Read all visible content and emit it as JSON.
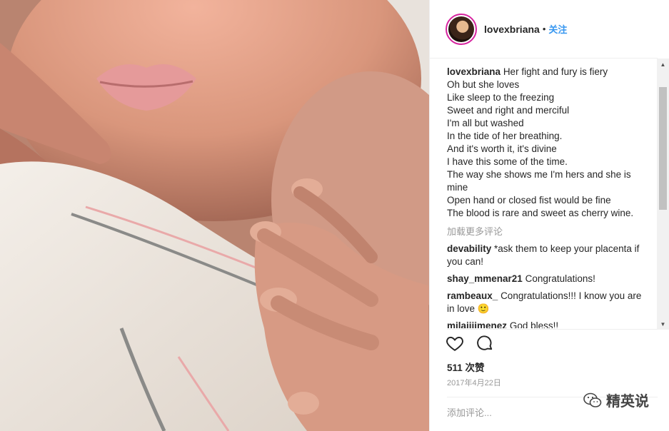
{
  "post": {
    "username": "lovexbriana",
    "dot": "•",
    "follow_label": "关注",
    "caption_lines": [
      "Her fight and fury is fiery",
      "Oh but she loves",
      "Like sleep to the freezing",
      "Sweet and right and merciful",
      "I'm all but washed",
      "In the tide of her breathing.",
      "And it's worth it, it's divine",
      "I have this some of the time.",
      "The way she shows me I'm hers and she is mine",
      "Open hand or closed fist would be fine",
      "The blood is rare and sweet as cherry wine."
    ],
    "load_more_label": "加载更多评论",
    "comments": [
      {
        "user": "devability",
        "text": "*ask them to keep your placenta if you can!"
      },
      {
        "user": "shay_mmenar21",
        "text": "Congratulations!"
      },
      {
        "user": "rambeaux_",
        "text": "Congratulations!!! I know you are in love 🙂"
      },
      {
        "user": "milajijimenez",
        "text": "God bless!!"
      }
    ],
    "likes_label": "511 次赞",
    "date": "2017年4月22日",
    "add_comment_placeholder": "添加评论...",
    "icons": {
      "like": "heart-icon",
      "comment": "comment-icon",
      "more": "more-options-icon"
    }
  },
  "watermark": {
    "text": "精英说",
    "icon": "wechat-icon"
  },
  "colors": {
    "link": "#3897f0",
    "muted": "#999999",
    "avatar_ring": "#d6249f"
  }
}
